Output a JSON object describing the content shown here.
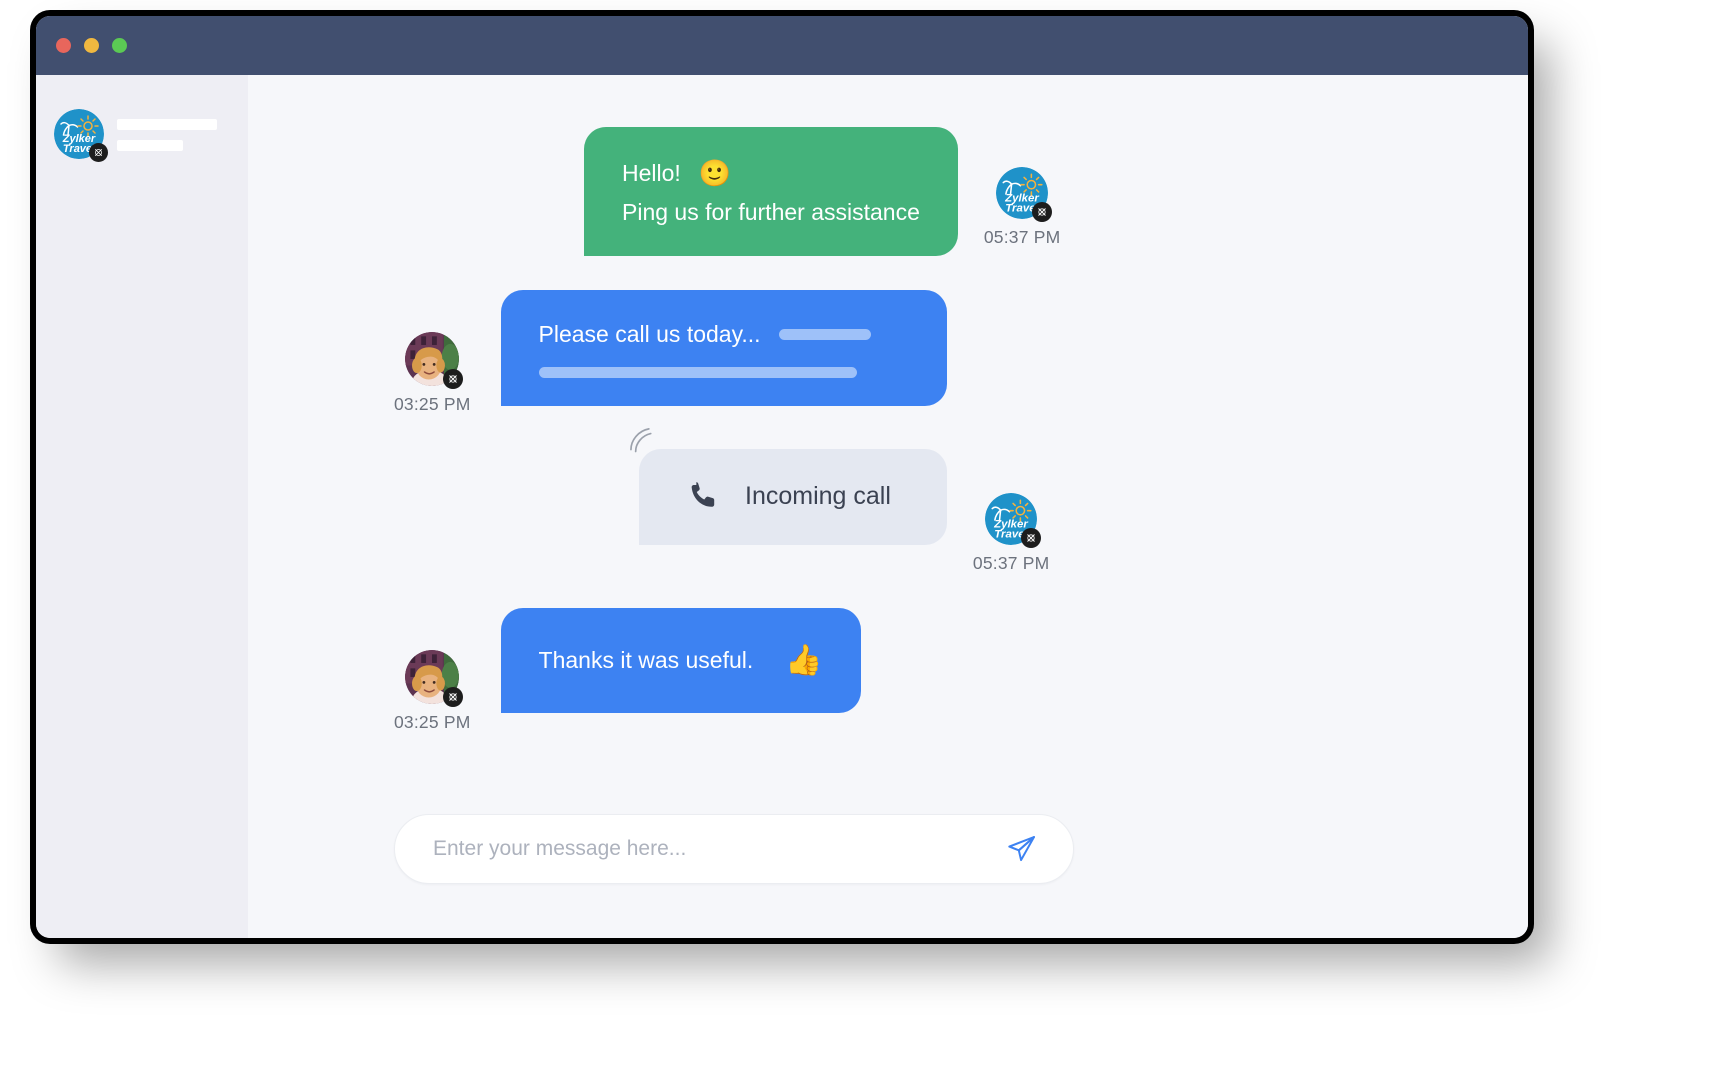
{
  "window": {
    "titlebar_color": "#414f6f",
    "traffic_lights": [
      {
        "name": "close",
        "color": "#e8665c"
      },
      {
        "name": "minimize",
        "color": "#f0b840"
      },
      {
        "name": "maximize",
        "color": "#5bc954"
      }
    ]
  },
  "sidebar": {
    "contact": {
      "avatar_name": "zylker-travel-logo",
      "avatar_alt": "Zylker Travel",
      "name_placeholder": "",
      "subtitle_placeholder": ""
    }
  },
  "chat": {
    "messages": [
      {
        "id": "msg-1",
        "sender": "agent",
        "side": "right",
        "type": "text",
        "bubble_color": "#44b27b",
        "lines": [
          "Hello!",
          "Ping us for further assistance"
        ],
        "emoji": "🙂",
        "avatar_alt": "Zylker Travel",
        "timestamp": "05:37 PM"
      },
      {
        "id": "msg-2",
        "sender": "user",
        "side": "left",
        "type": "text",
        "bubble_color": "#3d82f2",
        "lines": [
          "Please call us today..."
        ],
        "avatar_alt": "Customer photo",
        "timestamp": "03:25 PM"
      },
      {
        "id": "msg-3",
        "sender": "agent",
        "side": "right",
        "type": "call",
        "bubble_color": "#e4e8f1",
        "label": "Incoming call",
        "icon": "phone-icon",
        "avatar_alt": "Zylker Travel",
        "timestamp": "05:37 PM"
      },
      {
        "id": "msg-4",
        "sender": "user",
        "side": "left",
        "type": "text",
        "bubble_color": "#3d82f2",
        "lines": [
          "Thanks it was useful."
        ],
        "emoji": "👍",
        "avatar_alt": "Customer photo",
        "timestamp": "03:25 PM"
      }
    ]
  },
  "composer": {
    "placeholder": "Enter your message here...",
    "value": "",
    "send_icon": "send-paper-plane-icon",
    "send_icon_color": "#3d82f2"
  }
}
